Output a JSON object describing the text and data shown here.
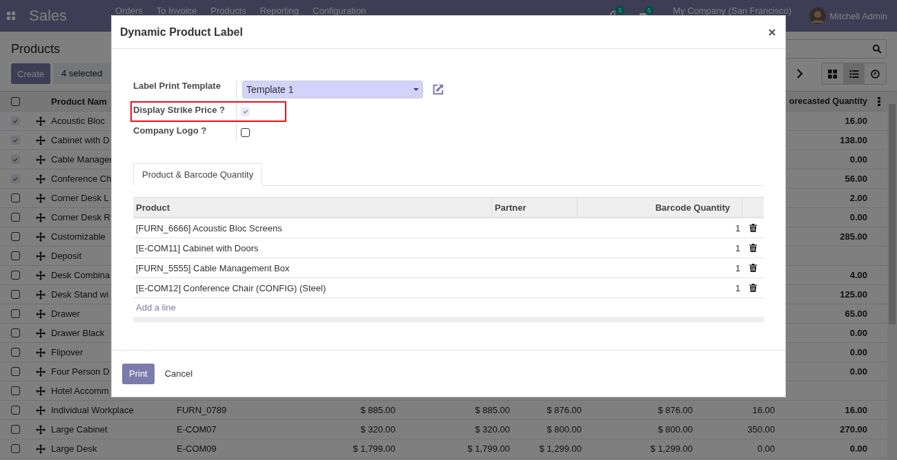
{
  "topbar": {
    "app": "Sales",
    "menu": [
      "Orders",
      "To Invoice",
      "Products",
      "Reporting",
      "Configuration"
    ],
    "activity_count": "5",
    "message_count": "5",
    "company": "My Company (San Francisco)",
    "user": "Mitchell Admin"
  },
  "control_panel": {
    "title": "Products",
    "create": "Create",
    "selection": "4 selected",
    "views": [
      {
        "kind": "kanban",
        "selected": false
      },
      {
        "kind": "list",
        "selected": true
      },
      {
        "kind": "activity",
        "selected": false
      }
    ]
  },
  "list": {
    "select_all": false,
    "columns": [
      "Product Nam",
      "orecasted Quantity"
    ],
    "rows": [
      {
        "checked": true,
        "name": "Acoustic Bloc",
        "forecast": "16.00"
      },
      {
        "checked": true,
        "name": "Cabinet with D",
        "forecast": "138.00"
      },
      {
        "checked": true,
        "name": "Cable Manager",
        "forecast": "0.00"
      },
      {
        "checked": true,
        "name": "Conference Ch",
        "forecast": "56.00"
      },
      {
        "checked": false,
        "name": "Corner Desk L",
        "forecast": "2.00"
      },
      {
        "checked": false,
        "name": "Corner Desk R",
        "forecast": "0.00"
      },
      {
        "checked": false,
        "name": "Customizable",
        "forecast": "285.00"
      },
      {
        "checked": false,
        "name": "Deposit"
      },
      {
        "checked": false,
        "name": "Desk Combina",
        "forecast": "4.00"
      },
      {
        "checked": false,
        "name": "Desk Stand wi",
        "forecast": "125.00"
      },
      {
        "checked": false,
        "name": "Drawer",
        "forecast": "65.00"
      },
      {
        "checked": false,
        "name": "Drawer Black",
        "forecast": "0.00"
      },
      {
        "checked": false,
        "name": "Flipover",
        "forecast": "0.00"
      },
      {
        "checked": false,
        "name": "Four Person D",
        "forecast": "0.00"
      },
      {
        "checked": false,
        "name": "Hotel Accomm"
      },
      {
        "checked": false,
        "name": "Individual Workplace",
        "cells": [
          "FURN_0789",
          "$ 885.00",
          "$ 885.00",
          "$ 876.00",
          "$ 876.00",
          "16.00"
        ],
        "forecast": "16.00"
      },
      {
        "checked": false,
        "name": "Large Cabinet",
        "cells": [
          "E-COM07",
          "$ 320.00",
          "$ 320.00",
          "$ 800.00",
          "$ 800.00",
          "350.00"
        ],
        "forecast": "270.00"
      },
      {
        "checked": false,
        "name": "Large Desk",
        "cells": [
          "E-COM09",
          "$ 1,799.00",
          "$ 1,799.00",
          "$ 1,299.00",
          "$ 1,299.00",
          "0.00"
        ],
        "forecast": "0.00"
      }
    ]
  },
  "dialog": {
    "title": "Dynamic Product Label",
    "fields": [
      {
        "kind": "select",
        "label": "Label Print Template",
        "value": "Template 1",
        "highlighted": false
      },
      {
        "kind": "checkbox",
        "label": "Display Strike Price ?",
        "checked": true,
        "highlighted": true
      },
      {
        "kind": "checkbox",
        "label": "Company Logo ?",
        "checked": false,
        "highlighted": false
      }
    ],
    "tabs": [
      {
        "label": "Product & Barcode Quantity",
        "selected": true
      }
    ],
    "lines": {
      "columns": [
        "Product",
        "Partner",
        "Barcode Quantity"
      ],
      "rows": [
        {
          "product": "[FURN_6666] Acoustic Bloc Screens",
          "quantity": "1"
        },
        {
          "product": "[E-COM11] Cabinet with Doors",
          "quantity": "1"
        },
        {
          "product": "[FURN_5555] Cable Management Box",
          "quantity": "1"
        },
        {
          "product": "[E-COM12] Conference Chair (CONFIG) (Steel)",
          "quantity": "1"
        }
      ],
      "add_line": "Add a line"
    },
    "buttons": [
      {
        "kind": "primary",
        "label": "Print"
      },
      {
        "kind": "secondary",
        "label": "Cancel"
      }
    ]
  }
}
